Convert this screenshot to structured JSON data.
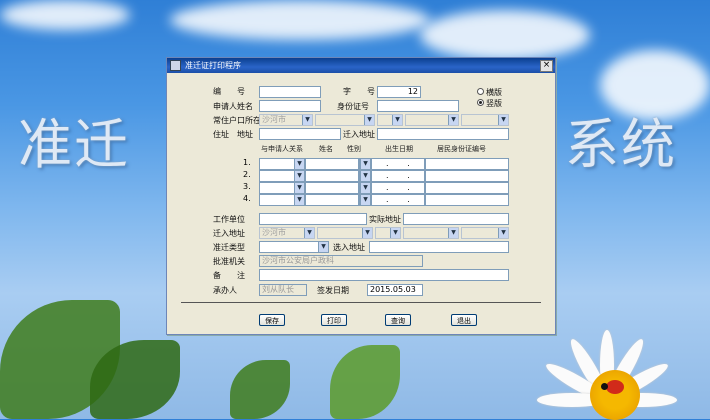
{
  "background": {
    "text_left": "准迁",
    "text_right": "系统"
  },
  "window": {
    "title": "准迁证打印程序",
    "close": "×"
  },
  "form": {
    "bianhao_label": "编　　号",
    "bianhao_value": "",
    "zihao_label": "字　　号",
    "zihao_value": "12",
    "radio1_label": "横版",
    "radio2_label": "竖版",
    "shenqingren_label": "申请人姓名",
    "shenfenzheng_label": "身份证号",
    "huji_label": "常住户口所在地",
    "huji_value": "沙河市",
    "zhuzhi_label": "住址　地址",
    "qianru_label": "迁入地址",
    "table_headers": [
      "与申请人关系",
      "姓名",
      "性别",
      "出生日期",
      "居民身份证编号"
    ],
    "rows": [
      "1.",
      "2.",
      "3.",
      "4."
    ],
    "date_dots": ". .",
    "danwei_label": "工作单位",
    "danwei2_label": "实际地址",
    "qianrudi_label": "迁入地址",
    "qianrudi_value": "沙河市",
    "zhunqian_label": "准迁类型",
    "xuanze_label": "选入地址",
    "pizhunjiguan_label": "批准机关",
    "pizhunjiguan_value": "沙河市公安局户政科",
    "beizhu_label": "备　　注",
    "chengbanren_label": "承办人",
    "chengbanren_value": "刘从队长",
    "riqi_label": "签发日期",
    "riqi_value": "2015.05.03"
  },
  "buttons": {
    "save": "保存",
    "print": "打印",
    "query": "查询",
    "exit": "退出"
  }
}
